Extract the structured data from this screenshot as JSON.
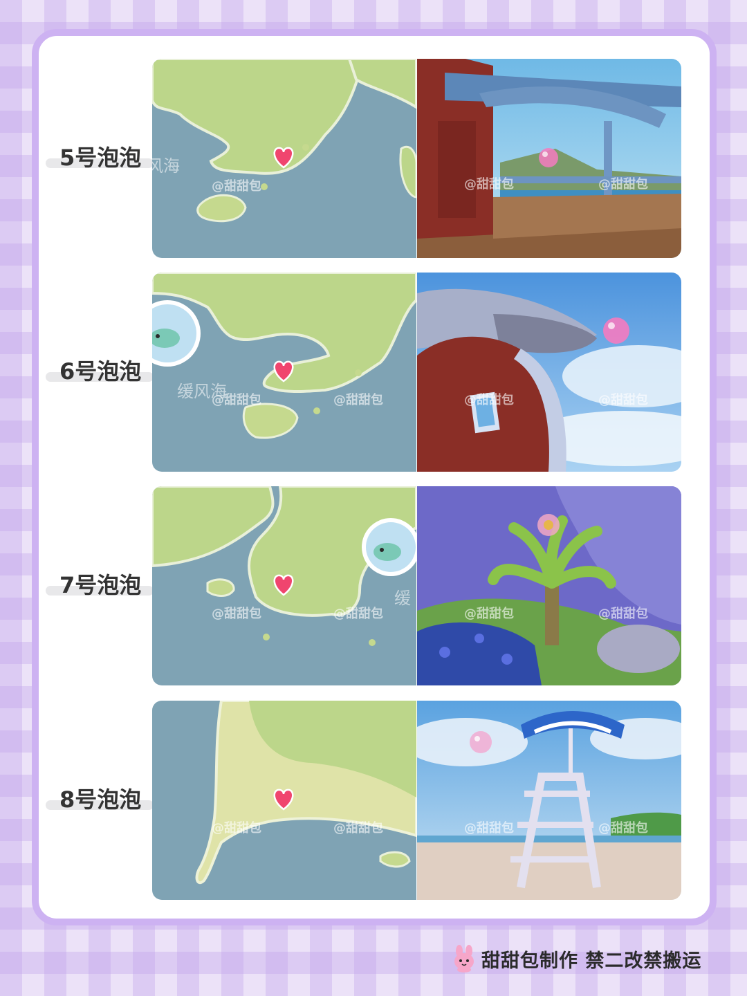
{
  "rows": [
    {
      "label": "5号泡泡",
      "map_watermark": "@甜甜包",
      "map_sea_name": "风海",
      "scene_watermark_1": "@甜甜包",
      "scene_watermark_2": "@甜甜包"
    },
    {
      "label": "6号泡泡",
      "map_watermark": "@甜甜包",
      "map_watermark_2": "@甜甜包",
      "map_sea_name": "缓风海",
      "scene_watermark_1": "@甜甜包",
      "scene_watermark_2": "@甜甜包"
    },
    {
      "label": "7号泡泡",
      "map_watermark": "@甜甜包",
      "map_watermark_2": "@甜甜包",
      "map_sea_name": "缓",
      "scene_watermark_1": "@甜甜包",
      "scene_watermark_2": "@甜甜包"
    },
    {
      "label": "8号泡泡",
      "map_watermark": "@甜甜包",
      "map_watermark_2": "@甜甜包",
      "scene_watermark_1": "@甜甜包",
      "scene_watermark_2": "@甜甜包"
    }
  ],
  "footer": {
    "text": "甜甜包制作 禁二改禁搬运"
  },
  "icons": {
    "marker": "heart-marker-icon",
    "bubble": "pink-bubble-icon",
    "mascot": "pink-bunny-icon",
    "fish_badge": "fish-badge-icon"
  },
  "colors": {
    "marker": "#f0456e",
    "frame_border": "#cdb2f2",
    "sea": "#7fa3b4",
    "land": "#bcd68a"
  }
}
